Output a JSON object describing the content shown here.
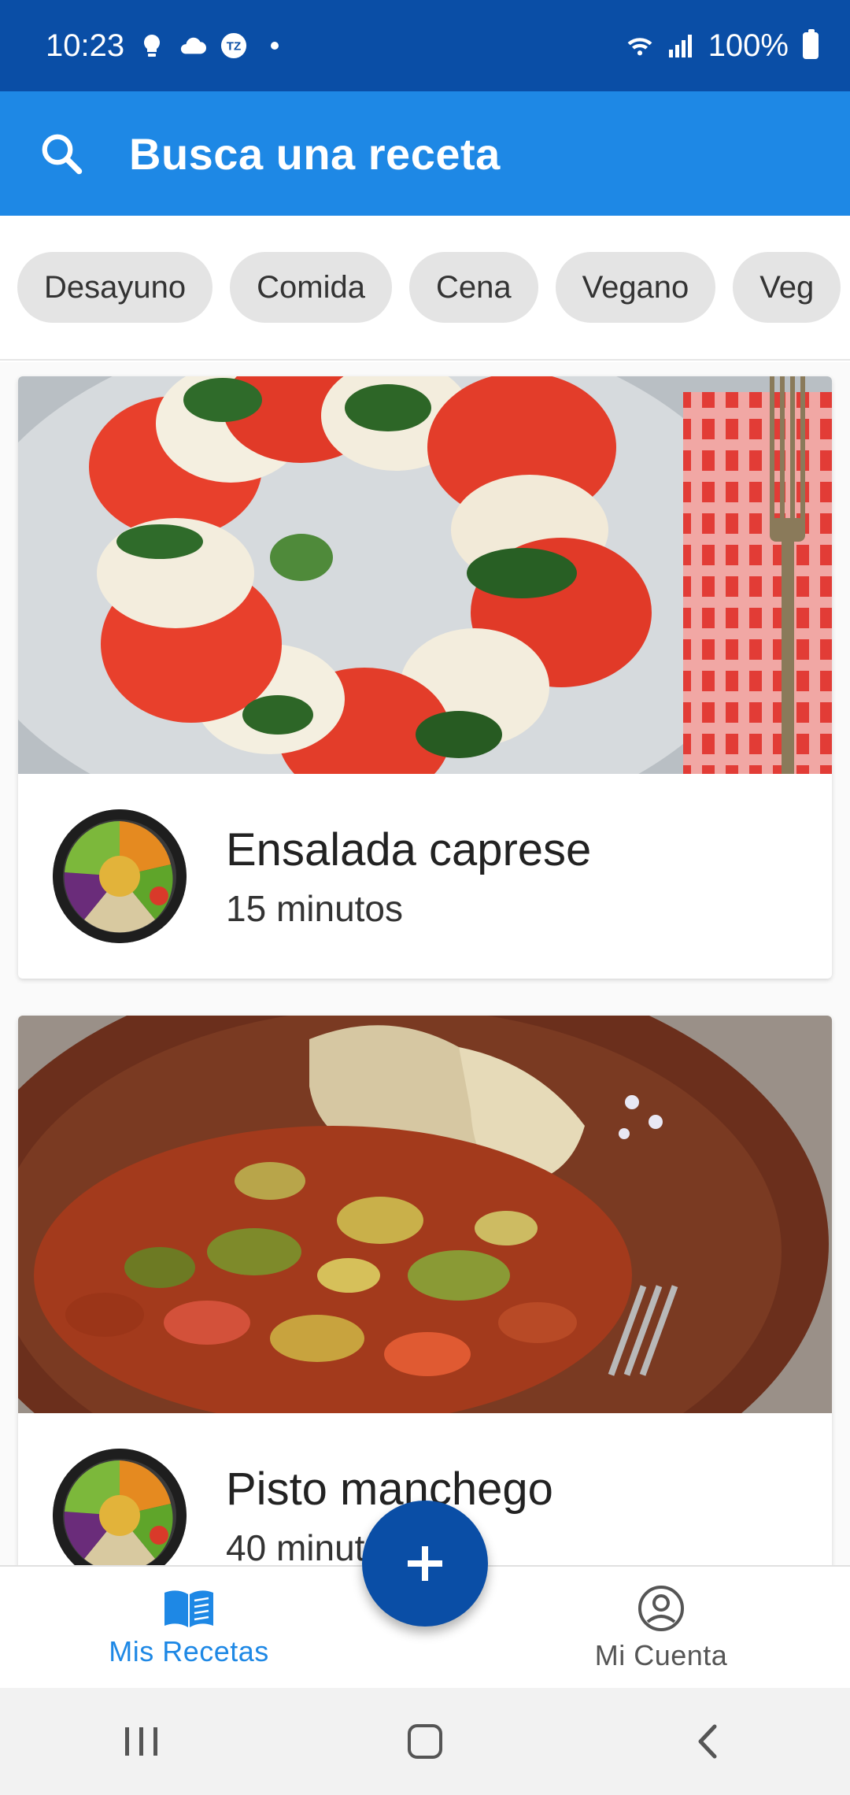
{
  "status_bar": {
    "time": "10:23",
    "battery_text": "100%",
    "left_icons": [
      "bulb-icon",
      "cloud-icon",
      "tz-app-icon",
      "dot-icon"
    ],
    "right_icons": [
      "wifi-icon",
      "signal-icon",
      "battery-icon"
    ]
  },
  "search": {
    "placeholder": "Busca una receta",
    "icon": "search-icon"
  },
  "chips": [
    "Desayuno",
    "Comida",
    "Cena",
    "Vegano",
    "Veg"
  ],
  "recipes": [
    {
      "title": "Ensalada caprese",
      "time": "15 minutos",
      "image": "caprese-salad-photo",
      "avatar": "buddha-bowl-avatar"
    },
    {
      "title": "Pisto manchego",
      "time": "40 minutos",
      "image": "pisto-photo",
      "avatar": "buddha-bowl-avatar"
    }
  ],
  "bottom_nav": {
    "left_label": "Mis Recetas",
    "right_label": "Mi Cuenta",
    "fab_icon": "plus-icon"
  },
  "colors": {
    "status_bar": "#0a4ea6",
    "header": "#1e88e5",
    "fab": "#0a4ea6",
    "active_nav": "#1e88e5"
  }
}
